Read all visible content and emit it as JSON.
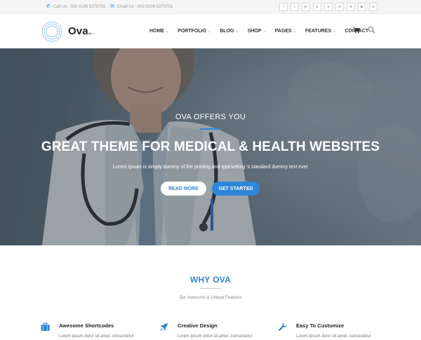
{
  "topbar": {
    "call": "Call Us : 002 0106 5370701",
    "email": "Email Us : 002 0106 5370701",
    "socials": [
      {
        "icon": "facebook-icon",
        "glyph": "f"
      },
      {
        "icon": "twitter-icon",
        "glyph": "t"
      },
      {
        "icon": "google-plus-icon",
        "glyph": "g+"
      },
      {
        "icon": "pinterest-icon",
        "glyph": "p"
      },
      {
        "icon": "vimeo-icon",
        "glyph": "v"
      },
      {
        "icon": "linkedin-icon",
        "glyph": "in"
      },
      {
        "icon": "dribbble-icon",
        "glyph": "⊕"
      },
      {
        "icon": "youtube-icon",
        "glyph": "▶"
      },
      {
        "icon": "rss-icon",
        "glyph": "≋"
      }
    ]
  },
  "header": {
    "logo_name": "Ova",
    "logo_dot": ".",
    "logo_tag": "Health",
    "nav": [
      {
        "label": "HOME",
        "dropdown": true
      },
      {
        "label": "PORTFOLIO",
        "dropdown": true
      },
      {
        "label": "BLOG",
        "dropdown": true
      },
      {
        "label": "SHOP",
        "dropdown": true
      },
      {
        "label": "PAGES",
        "dropdown": true
      },
      {
        "label": "FEATURES",
        "dropdown": true
      },
      {
        "label": "CONTACT",
        "dropdown": false
      }
    ]
  },
  "hero": {
    "subtitle": "OVA OFFERS YOU",
    "title": "GREAT THEME FOR MEDICAL & HEALTH WEBSITES",
    "description": "Lorem Ipsum is simply dummy of the printing and typesetting 's standard dummy text ever",
    "read_more": "READ MORE",
    "get_started": "GET STARTED"
  },
  "why": {
    "title": "WHY OVA",
    "subtitle": "Our Awesome & Unique Features",
    "features": [
      {
        "title": "Awesome Shortcodes",
        "text": "Lorem ipsum dolor sit amet, consectetur",
        "icon": "briefcase-icon"
      },
      {
        "title": "Creative Design",
        "text": "Lorem ipsum dolor sit amet, consectetur",
        "icon": "rocket-icon"
      },
      {
        "title": "Easy To Customize",
        "text": "Lorem ipsum dolor sit amet, consectetur",
        "icon": "wrench-icon"
      }
    ]
  },
  "colors": {
    "accent": "#2e86d9",
    "topbar_bg": "#f5f5f5",
    "hero_overlay": "#3b4a57"
  }
}
